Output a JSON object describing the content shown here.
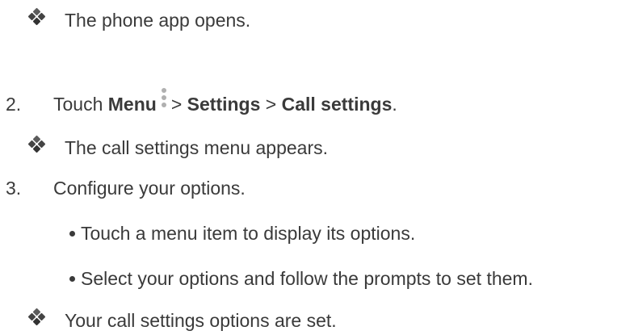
{
  "result1": {
    "icon": "diamond-bullet-icon",
    "text": "The phone app opens."
  },
  "step2": {
    "number": "2.",
    "touch": "Touch",
    "menu": "Menu",
    "menu_icon": "vertical-dots-menu-icon",
    "sep1": ">",
    "settings": "Settings",
    "sep2": ">",
    "call_settings": "Call settings",
    "period": "."
  },
  "result2": {
    "icon": "diamond-bullet-icon",
    "text": "The call settings menu appears."
  },
  "step3": {
    "number": "3.",
    "text": "Configure your options."
  },
  "bullets": [
    {
      "text": "Touch a menu item to display its options."
    },
    {
      "text": "Select your options and follow the prompts to set them."
    }
  ],
  "result3": {
    "icon": "diamond-bullet-icon",
    "text": "Your call settings options are set."
  }
}
